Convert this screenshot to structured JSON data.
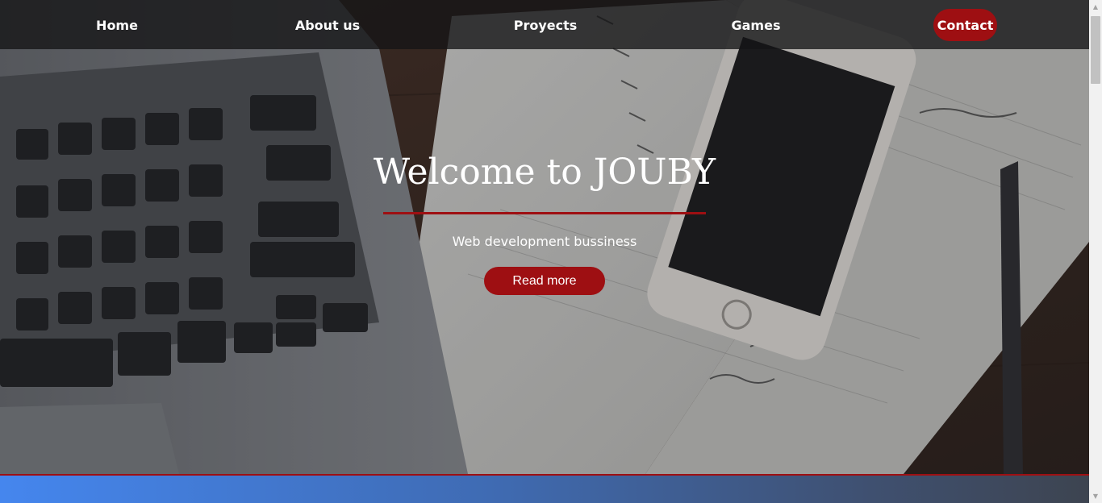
{
  "nav": {
    "items": [
      {
        "label": "Home"
      },
      {
        "label": "About us"
      },
      {
        "label": "Proyects"
      },
      {
        "label": "Games"
      }
    ],
    "contact_label": "Contact"
  },
  "hero": {
    "title": "Welcome to JOUBY",
    "subtitle": "Web development bussiness",
    "button_label": "Read more"
  },
  "colors": {
    "accent": "#9e0f12",
    "navbar_bg": "#141416",
    "section_gradient_start": "#4586ee",
    "section_gradient_end": "#3d4450"
  },
  "scrollbar": {
    "up_icon": "scroll-up-arrow-icon",
    "down_icon": "scroll-down-arrow-icon"
  }
}
